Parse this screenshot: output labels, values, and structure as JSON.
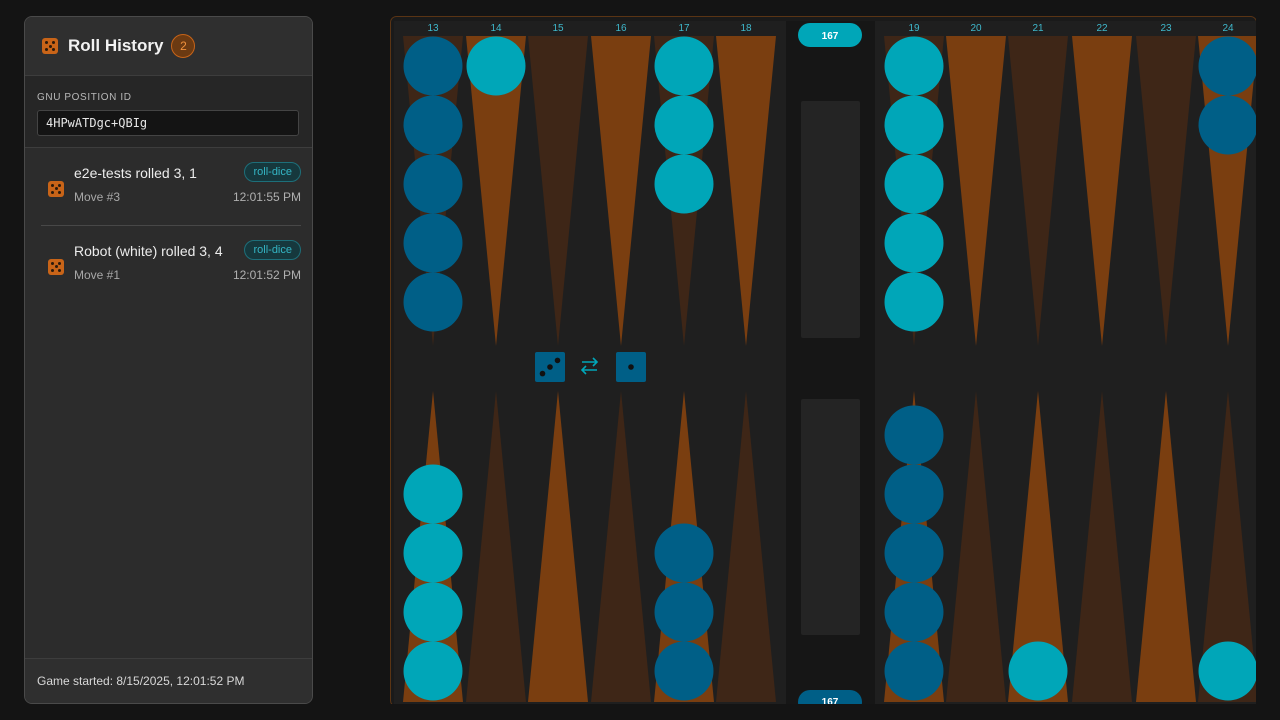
{
  "panel": {
    "title": "Roll History",
    "count": "2",
    "position_label": "GNU POSITION ID",
    "position_id": "4HPwATDgc+QBIg",
    "rolls": [
      {
        "text": "e2e-tests rolled 3, 1",
        "tag": "roll-dice",
        "move": "Move #3",
        "time": "12:01:55 PM"
      },
      {
        "text": "Robot (white) rolled 3, 4",
        "tag": "roll-dice",
        "move": "Move #1",
        "time": "12:01:52 PM"
      }
    ],
    "footer": "Game started: 8/15/2025, 12:01:52 PM"
  },
  "board": {
    "top_point_numbers": [
      "13",
      "14",
      "15",
      "16",
      "17",
      "18",
      "19",
      "20",
      "21",
      "22",
      "23",
      "24"
    ],
    "pip_count_top": "167",
    "pip_count_bottom": "167",
    "dice_values": [
      3,
      1
    ],
    "swap_icon": "swap-arrows-icon",
    "colors": {
      "light_checker": "#00a6b8",
      "dark_checker": "#005f87",
      "orange_point": "#7a3e10",
      "brown_point": "#3e2617",
      "board_bg": "#1f1f1f",
      "accent": "#c86418"
    },
    "checkers": {
      "top": [
        {
          "point": "13",
          "color": "dark",
          "count": 5
        },
        {
          "point": "14",
          "color": "light",
          "count": 1
        },
        {
          "point": "17",
          "color": "light",
          "count": 3
        },
        {
          "point": "19",
          "color": "light",
          "count": 5
        },
        {
          "point": "24",
          "color": "dark",
          "count": 2
        }
      ],
      "bottom": [
        {
          "column": 1,
          "color": "light",
          "count": 4
        },
        {
          "column": 5,
          "color": "dark",
          "count": 3
        },
        {
          "column": 7,
          "color": "dark",
          "count": 5
        },
        {
          "column": 9,
          "color": "light",
          "count": 1
        },
        {
          "column": 12,
          "color": "light",
          "count": 1
        }
      ]
    }
  }
}
